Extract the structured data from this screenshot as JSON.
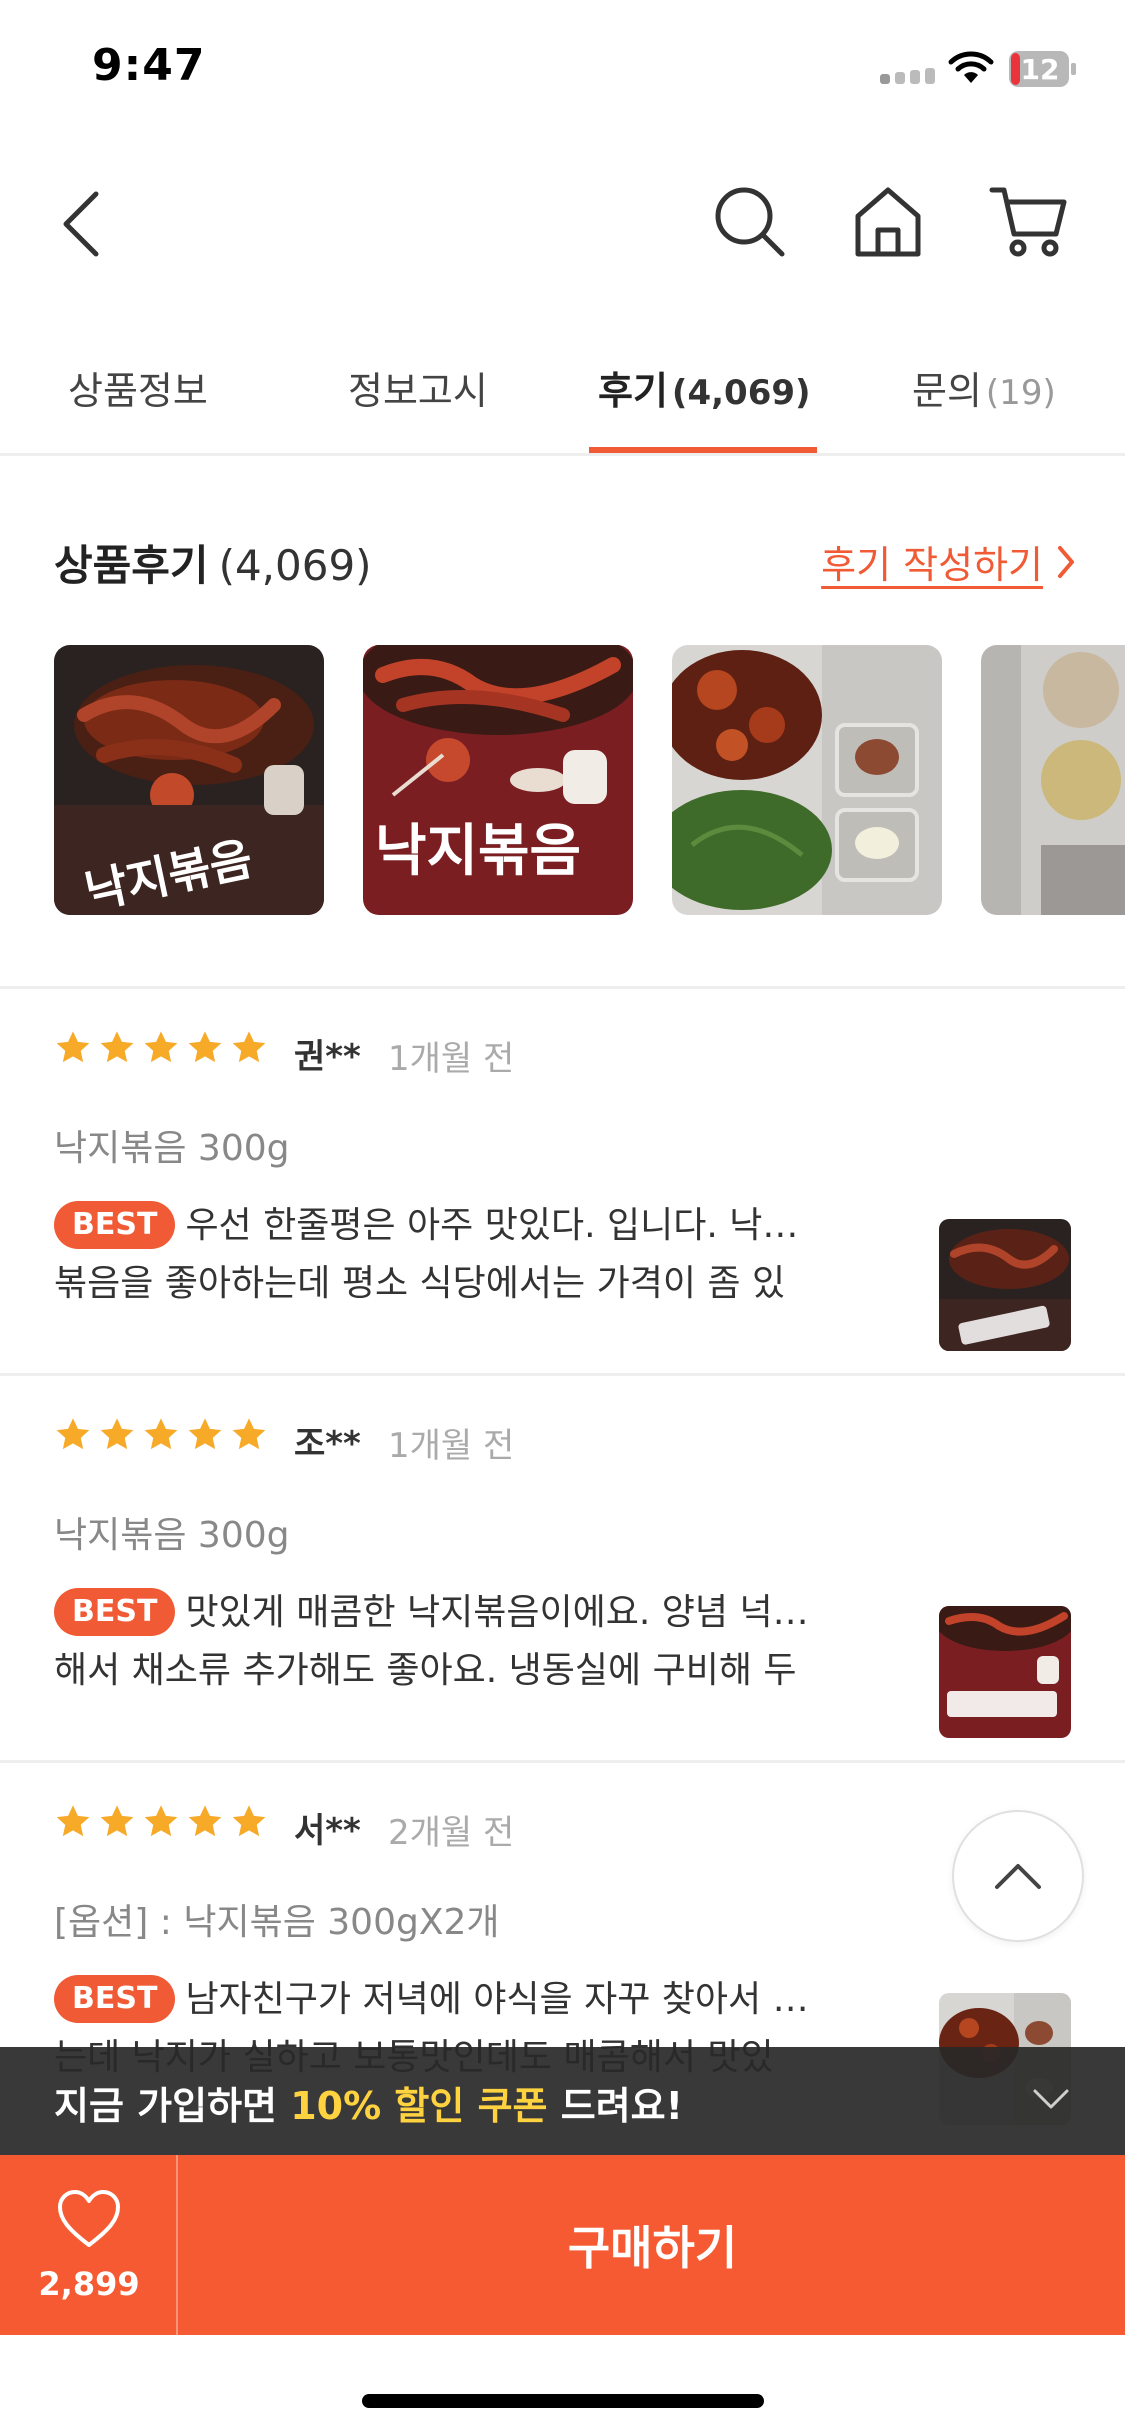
{
  "status_bar": {
    "time": "9:47",
    "battery": "12",
    "icons": [
      "signal-icon",
      "wifi-icon",
      "battery-icon"
    ]
  },
  "nav": {
    "icons": [
      "back-icon",
      "search-icon",
      "home-icon",
      "cart-icon"
    ]
  },
  "tabs": [
    {
      "label": "상품정보",
      "count": ""
    },
    {
      "label": "정보고시",
      "count": ""
    },
    {
      "label": "후기",
      "count": "(4,069)"
    },
    {
      "label": "문의",
      "count": "(19)"
    }
  ],
  "reviews_section": {
    "title": "상품후기",
    "count": "(4,069)",
    "write_link": "후기 작성하기"
  },
  "photo_text": {
    "label_a": "낙지볶음",
    "label_b": "낙지볶음"
  },
  "reviews": [
    {
      "rating": 5,
      "reviewer": "권**",
      "date": "1개월 전",
      "option": "낙지볶음 300g",
      "badge": "BEST",
      "line1": "우선 한줄평은 아주 맛있다. 입니다. 낙…",
      "line2": "볶음을 좋아하는데 평소 식당에서는 가격이 좀 있"
    },
    {
      "rating": 5,
      "reviewer": "조**",
      "date": "1개월 전",
      "option": "낙지볶음 300g",
      "badge": "BEST",
      "line1": "맛있게 매콤한 낙지볶음이에요. 양념 넉…",
      "line2": "해서 채소류 추가해도 좋아요. 냉동실에 구비해 두"
    },
    {
      "rating": 5,
      "reviewer": "서**",
      "date": "2개월 전",
      "option": "[옵션] : 낙지볶음 300gX2개",
      "badge": "BEST",
      "line1": "남자친구가 저녁에 야식을 자꾸 찾아서 …",
      "line2": "는데 낙지가 실하고 보통맛인데도 매콤해서 맛있"
    }
  ],
  "coupon": {
    "prefix": "지금 가입하면 ",
    "highlight": "10% 할인 쿠폰",
    "suffix": " 드려요!"
  },
  "bottom_bar": {
    "like_count": "2,899",
    "buy_label": "구매하기"
  },
  "colors": {
    "accent": "#f05a35",
    "buy_bar": "#f55a33",
    "star": "#f7a928",
    "coupon_highlight": "#ffd23f"
  }
}
